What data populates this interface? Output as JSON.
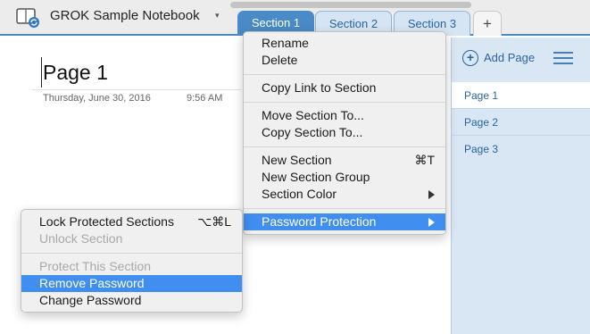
{
  "notebook": {
    "title": "GROK Sample Notebook",
    "caret": "▾",
    "icon": "notebook-sync-icon"
  },
  "tabs": [
    {
      "label": "Section 1",
      "active": true
    },
    {
      "label": "Section 2",
      "active": false
    },
    {
      "label": "Section 3",
      "active": false
    }
  ],
  "add_tab_label": "+",
  "page": {
    "title": "Page 1",
    "date": "Thursday, June 30, 2016",
    "time": "9:56 AM"
  },
  "right_panel": {
    "add_page_label": "Add Page",
    "add_icon": "plus-circle-icon",
    "sort_icon": "list-icon",
    "pages": [
      "Page 1",
      "Page 2",
      "Page 3"
    ],
    "selected_page": "Page 1"
  },
  "section_menu": {
    "groups": [
      [
        {
          "label": "Rename"
        },
        {
          "label": "Delete"
        }
      ],
      [
        {
          "label": "Copy Link to Section"
        }
      ],
      [
        {
          "label": "Move Section To..."
        },
        {
          "label": "Copy Section To..."
        }
      ],
      [
        {
          "label": "New Section",
          "shortcut": "⌘T"
        },
        {
          "label": "New Section Group"
        },
        {
          "label": "Section Color",
          "submenu": true
        }
      ],
      [
        {
          "label": "Password Protection",
          "submenu": true,
          "highlighted": true
        }
      ]
    ]
  },
  "password_menu": {
    "groups": [
      [
        {
          "label": "Lock Protected Sections",
          "shortcut": "⌥⌘L"
        },
        {
          "label": "Unlock Section",
          "disabled": true
        }
      ],
      [
        {
          "label": "Protect This Section",
          "disabled": true
        },
        {
          "label": "Remove Password",
          "highlighted": true
        },
        {
          "label": "Change Password"
        }
      ]
    ]
  },
  "colors": {
    "accent": "#4a8ac6",
    "highlight": "#3f8ef0",
    "panel": "#d9e6f3",
    "link": "#2a64a0"
  }
}
